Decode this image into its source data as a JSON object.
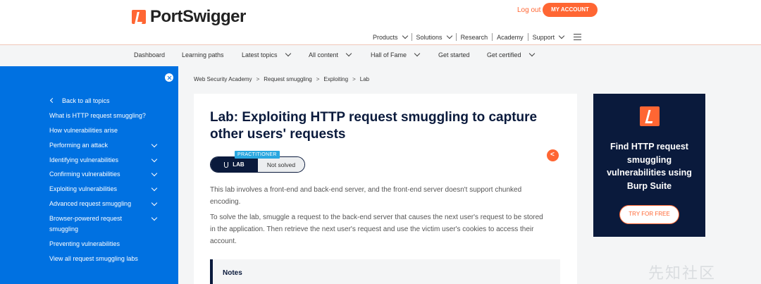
{
  "header": {
    "logo_text": "PortSwigger",
    "login_label": "Log out",
    "account_label": "MY ACCOUNT",
    "nav": [
      "Products",
      "Solutions",
      "Research",
      "Academy",
      "Support"
    ]
  },
  "subnav": [
    "Dashboard",
    "Learning paths",
    "Latest topics",
    "All content",
    "Hall of Fame",
    "Get started",
    "Get certified"
  ],
  "sidebar": {
    "back_label": "Back to all topics",
    "items": [
      "What is HTTP request smuggling?",
      "How vulnerabilities arise",
      "Performing an attack",
      "Identifying vulnerabilities",
      "Confirming vulnerabilities",
      "Exploiting vulnerabilities",
      "Advanced request smuggling",
      "Browser-powered request",
      "smuggling",
      "Preventing vulnerabilities",
      "View all request smuggling labs"
    ]
  },
  "breadcrumb": [
    "Web Security Academy",
    "Request smuggling",
    "Exploiting",
    "Lab"
  ],
  "lab": {
    "title_line1": "Lab: Exploiting HTTP request smuggling to capture",
    "title_line2": "other users' requests",
    "level": "PRACTITIONER",
    "badge_label": "LAB",
    "status": "Not solved",
    "para1_line1": "This lab involves a front-end and back-end server, and the front-end server doesn't support chunked",
    "para1_line2": "encoding.",
    "para2_line1": "To solve the lab, smuggle a request to the back-end server that causes the next user's request to be stored",
    "para2_line2": "in the application. Then retrieve the next user's request and use the victim user's cookies to access their",
    "para2_line3": "account.",
    "notes_label": "Notes"
  },
  "promo": {
    "line1": "Find HTTP request",
    "line2": "smuggling",
    "line3": "vulnerabilities using",
    "line4": "Burp Suite",
    "button": "TRY FOR FREE"
  },
  "watermark": "先知社区",
  "colors": {
    "accent": "#ff6633",
    "sidebar": "#0071e1",
    "navy": "#0a1a3c",
    "practitioner": "#2aa7e0"
  }
}
